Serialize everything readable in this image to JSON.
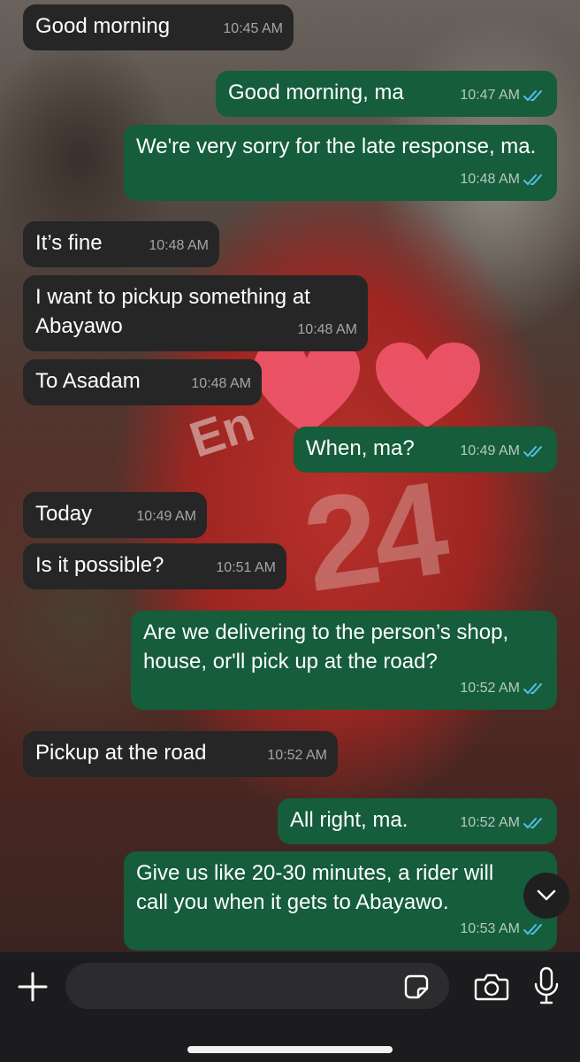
{
  "messages": [
    {
      "text": "Good morning",
      "time": "10:45 AM",
      "dir": "in"
    },
    {
      "text": "Good morning, ma",
      "time": "10:47 AM",
      "dir": "out"
    },
    {
      "text": "We're very sorry for the late response, ma.",
      "time": "10:48 AM",
      "dir": "out"
    },
    {
      "text": "It’s fine",
      "time": "10:48 AM",
      "dir": "in"
    },
    {
      "text": "I want to pickup something at Abayawo",
      "time": "10:48 AM",
      "dir": "in"
    },
    {
      "text": "To Asadam",
      "time": "10:48 AM",
      "dir": "in"
    },
    {
      "text": "When, ma?",
      "time": "10:49 AM",
      "dir": "out"
    },
    {
      "text": "Today",
      "time": "10:49 AM",
      "dir": "in"
    },
    {
      "text": "Is it possible?",
      "time": "10:51 AM",
      "dir": "in"
    },
    {
      "text": "Are we delivering to the person’s shop, house, or'll pick up at the road?",
      "time": "10:52 AM",
      "dir": "out"
    },
    {
      "text": "Pickup at the road",
      "time": "10:52 AM",
      "dir": "in"
    },
    {
      "text": "All right, ma.",
      "time": "10:52 AM",
      "dir": "out"
    },
    {
      "text": "Give us like 20-30 minutes, a rider will call you when it gets to Abayawo.",
      "time": "10:53 AM",
      "dir": "out"
    }
  ],
  "composer": {
    "placeholder": ""
  },
  "icons": {
    "attach": "plus-icon",
    "sticker": "sticker-icon",
    "camera": "camera-icon",
    "mic": "microphone-icon",
    "scroll": "chevron-down-icon",
    "read": "double-check-icon"
  },
  "colors": {
    "incoming_bubble": "#262626",
    "outgoing_bubble": "#155d3b",
    "read_ticks": "#53bdeb",
    "heart": "#f0566a"
  }
}
